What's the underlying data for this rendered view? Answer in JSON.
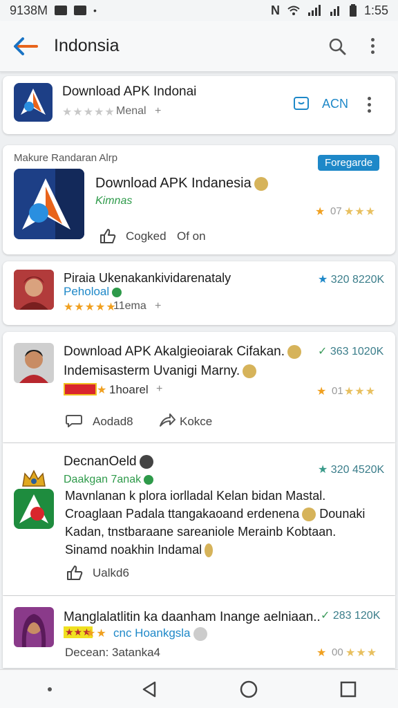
{
  "status_bar": {
    "time_left": "9138M",
    "time_right": "1:55"
  },
  "app_bar": {
    "title": "Indonsia"
  },
  "card1": {
    "title": "Download APK Indonai",
    "rating_text": "Menal",
    "action_label": "ACN"
  },
  "card2": {
    "section_label": "Makure Randaran Alrp",
    "badge": "Foregarde",
    "title": "Download APK Indanesia",
    "subtitle": "Kimnas",
    "like_label": "Cogked",
    "share_label": "Of on",
    "rating_text": "07"
  },
  "card3": {
    "title": "Piraia Ukenakankividarenataly",
    "subtitle": "Peholoal",
    "rating_text": "11ema",
    "score": "320 8220K"
  },
  "card4": {
    "title_line1": "Download APK Akalgieoiarak Cifakan.",
    "title_line2": "Indemisasterm Uvanigi Marny.",
    "tag": "1hoarel",
    "score": "363 1020K",
    "rating_text": "01",
    "like_label": "Aodad8",
    "share_label": "Kokce"
  },
  "card5": {
    "title": "DecnanOeld",
    "subtitle": "Daakgan 7anak",
    "score": "320 4520K",
    "body_line1": "Mavnlanan k plora iorlladal Kelan bidan Mastal.",
    "body_line2": "Croaglaan Padala ttangakaoand erdenena",
    "body_line2_tail": "Dounaki",
    "body_line3": "Kadan, tnstbaraane sareaniole Merainb Kobtaan.",
    "body_line4": "Sinamd noakhin Indamal",
    "like_label": "Ualkd6"
  },
  "card6": {
    "title": "Manglalatlitin ka daanham Inange aelniaan..",
    "subtitle": "cnc Hoankgsla",
    "score": "283 120K",
    "meta": "Decean: 3atanka4",
    "rating_text": "00"
  },
  "colors": {
    "accent_blue": "#1e88c8",
    "star_orange": "#f0a020",
    "green": "#2e9a4a",
    "back_arrow_blue": "#1a73c4",
    "back_arrow_orange": "#e8641c"
  }
}
